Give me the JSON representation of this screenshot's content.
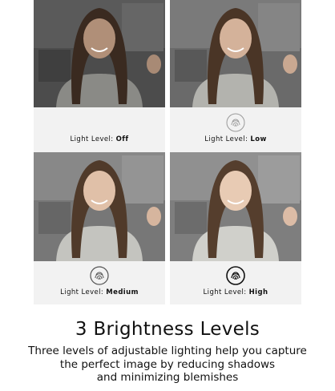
{
  "panels": [
    {
      "label_prefix": "Light Level:",
      "level": "Off",
      "icon": "fingerprint-icon",
      "icon_style": "none",
      "brightness": 0
    },
    {
      "label_prefix": "Light Level:",
      "level": "Low",
      "icon": "fingerprint-icon",
      "icon_style": "light",
      "brightness": 1
    },
    {
      "label_prefix": "Light Level:",
      "level": "Medium",
      "icon": "fingerprint-icon",
      "icon_style": "medium",
      "brightness": 2
    },
    {
      "label_prefix": "Light Level:",
      "level": "High",
      "icon": "fingerprint-icon",
      "icon_style": "dark",
      "brightness": 3
    }
  ],
  "headline": "3 Brightness Levels",
  "description": {
    "line1": "Three levels of adjustable lighting help you capture",
    "line2": "the perfect image by reducing shadows",
    "line3": "and minimizing blemishes"
  },
  "colors": {
    "caption_bg": "#f2f2f2",
    "text": "#111111",
    "icon_light": "#9a9a9a",
    "icon_medium": "#555555",
    "icon_dark": "#111111"
  }
}
